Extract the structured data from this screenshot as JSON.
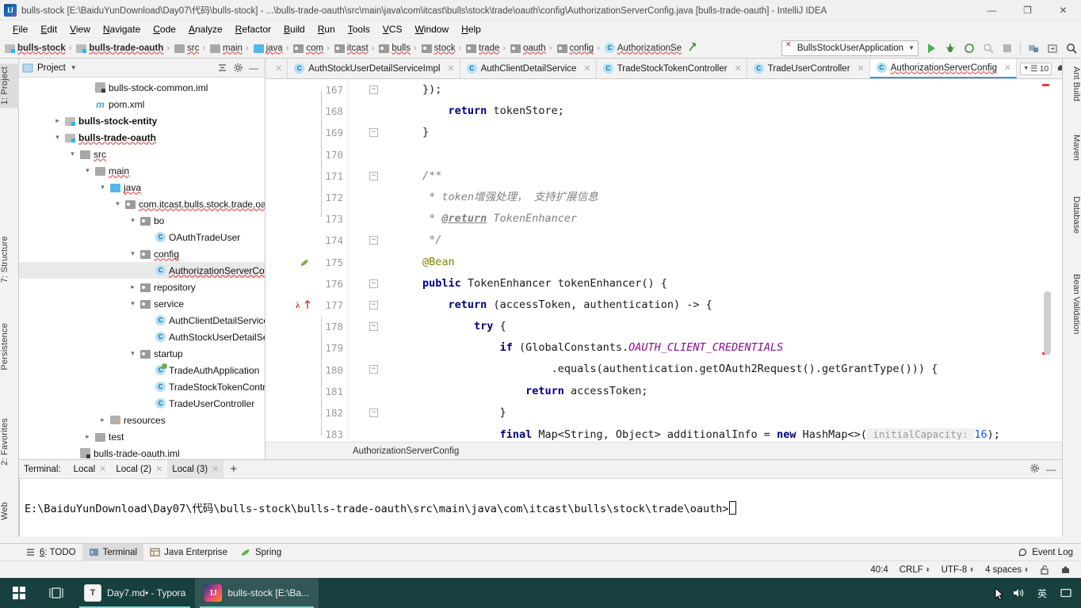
{
  "window": {
    "title": "bulls-stock [E:\\BaiduYunDownload\\Day07\\代码\\bulls-stock] - ...\\bulls-trade-oauth\\src\\main\\java\\com\\itcast\\bulls\\stock\\trade\\oauth\\config\\AuthorizationServerConfig.java [bulls-trade-oauth] - IntelliJ IDEA",
    "logo": "IJ",
    "minimize": "—",
    "maximize": "❐",
    "close": "✕"
  },
  "menu": [
    "File",
    "Edit",
    "View",
    "Navigate",
    "Code",
    "Analyze",
    "Refactor",
    "Build",
    "Run",
    "Tools",
    "VCS",
    "Window",
    "Help"
  ],
  "navbar": {
    "crumbs": [
      {
        "label": "bulls-stock",
        "icon": "module-icon",
        "bold": true
      },
      {
        "label": "bulls-trade-oauth",
        "icon": "module-icon",
        "bold": true
      },
      {
        "label": "src",
        "icon": "folder-icon",
        "bold": false
      },
      {
        "label": "main",
        "icon": "folder-icon",
        "bold": false
      },
      {
        "label": "java",
        "icon": "source-folder-icon",
        "bold": false
      },
      {
        "label": "com",
        "icon": "package-icon",
        "bold": false
      },
      {
        "label": "itcast",
        "icon": "package-icon",
        "bold": false
      },
      {
        "label": "bulls",
        "icon": "package-icon",
        "bold": false
      },
      {
        "label": "stock",
        "icon": "package-icon",
        "bold": false
      },
      {
        "label": "trade",
        "icon": "package-icon",
        "bold": false
      },
      {
        "label": "oauth",
        "icon": "package-icon",
        "bold": false
      },
      {
        "label": "config",
        "icon": "package-icon",
        "bold": false
      },
      {
        "label": "AuthorizationSe",
        "icon": "class-icon",
        "bold": false
      }
    ],
    "run_config": "BullsStockUserApplication",
    "buttons": [
      "run-icon",
      "debug-icon",
      "run-coverage-icon",
      "profiler-icon",
      "stop-icon",
      "build-project-icon",
      "select-opened-file-icon",
      "search-everywhere-icon"
    ]
  },
  "left_tool_tabs": [
    {
      "label": "1: Project",
      "selected": true
    },
    {
      "label": "7: Structure",
      "selected": false
    },
    {
      "label": "Persistence",
      "selected": false
    },
    {
      "label": "2: Favorites",
      "selected": false
    },
    {
      "label": "Web",
      "selected": false
    }
  ],
  "right_tool_tabs": [
    "Ant Build",
    "Maven",
    "Database",
    "Bean Validation"
  ],
  "project_panel": {
    "title": "Project",
    "collapse_all": "collapse-all-icon",
    "settings": "gear-icon",
    "hide": "hide-icon",
    "tree": [
      {
        "label": "bulls-stock-common.iml",
        "indent": 4,
        "icon": "iml-icon",
        "twisty": "",
        "bold": false,
        "selected": false,
        "squiggle": false
      },
      {
        "label": "pom.xml",
        "indent": 4,
        "icon": "maven-icon",
        "twisty": "",
        "bold": false,
        "selected": false,
        "squiggle": false
      },
      {
        "label": "bulls-stock-entity",
        "indent": 2,
        "icon": "module-icon",
        "twisty": "collapsed",
        "bold": true,
        "selected": false,
        "squiggle": false
      },
      {
        "label": "bulls-trade-oauth",
        "indent": 2,
        "icon": "module-icon",
        "twisty": "expanded",
        "bold": true,
        "selected": false,
        "squiggle": true
      },
      {
        "label": "src",
        "indent": 3,
        "icon": "folder-icon",
        "twisty": "expanded",
        "bold": false,
        "selected": false,
        "squiggle": true
      },
      {
        "label": "main",
        "indent": 4,
        "icon": "folder-icon",
        "twisty": "expanded",
        "bold": false,
        "selected": false,
        "squiggle": true
      },
      {
        "label": "java",
        "indent": 5,
        "icon": "source-folder-icon",
        "twisty": "expanded",
        "bold": false,
        "selected": false,
        "squiggle": true
      },
      {
        "label": "com.itcast.bulls.stock.trade.oa",
        "indent": 6,
        "icon": "package-icon",
        "twisty": "expanded",
        "bold": false,
        "selected": false,
        "squiggle": true
      },
      {
        "label": "bo",
        "indent": 7,
        "icon": "package-icon",
        "twisty": "expanded",
        "bold": false,
        "selected": false,
        "squiggle": false
      },
      {
        "label": "OAuthTradeUser",
        "indent": 8,
        "icon": "class-icon",
        "twisty": "",
        "bold": false,
        "selected": false,
        "squiggle": false
      },
      {
        "label": "config",
        "indent": 7,
        "icon": "package-icon",
        "twisty": "expanded",
        "bold": false,
        "selected": false,
        "squiggle": true
      },
      {
        "label": "AuthorizationServerCon",
        "indent": 8,
        "icon": "class-icon",
        "twisty": "",
        "bold": false,
        "selected": true,
        "squiggle": true
      },
      {
        "label": "repository",
        "indent": 7,
        "icon": "package-icon",
        "twisty": "collapsed",
        "bold": false,
        "selected": false,
        "squiggle": false
      },
      {
        "label": "service",
        "indent": 7,
        "icon": "package-icon",
        "twisty": "expanded",
        "bold": false,
        "selected": false,
        "squiggle": false
      },
      {
        "label": "AuthClientDetailService",
        "indent": 8,
        "icon": "class-icon",
        "twisty": "",
        "bold": false,
        "selected": false,
        "squiggle": false
      },
      {
        "label": "AuthStockUserDetailSe",
        "indent": 8,
        "icon": "class-icon",
        "twisty": "",
        "bold": false,
        "selected": false,
        "squiggle": false
      },
      {
        "label": "startup",
        "indent": 7,
        "icon": "package-icon",
        "twisty": "expanded",
        "bold": false,
        "selected": false,
        "squiggle": false
      },
      {
        "label": "TradeAuthApplication",
        "indent": 8,
        "icon": "spring-class-icon",
        "twisty": "",
        "bold": false,
        "selected": false,
        "squiggle": false
      },
      {
        "label": "TradeStockTokenContr",
        "indent": 8,
        "icon": "class-icon",
        "twisty": "",
        "bold": false,
        "selected": false,
        "squiggle": false
      },
      {
        "label": "TradeUserController",
        "indent": 8,
        "icon": "class-icon",
        "twisty": "",
        "bold": false,
        "selected": false,
        "squiggle": false
      },
      {
        "label": "resources",
        "indent": 5,
        "icon": "resources-icon",
        "twisty": "collapsed",
        "bold": false,
        "selected": false,
        "squiggle": false
      },
      {
        "label": "test",
        "indent": 4,
        "icon": "folder-icon",
        "twisty": "collapsed",
        "bold": false,
        "selected": false,
        "squiggle": false
      },
      {
        "label": "bulls-trade-oauth.iml",
        "indent": 3,
        "icon": "iml-icon",
        "twisty": "",
        "bold": false,
        "selected": false,
        "squiggle": false
      }
    ]
  },
  "editor": {
    "tabs": [
      {
        "label": "AuthStockUserDetailServiceImpl",
        "icon": "class-icon",
        "active": false
      },
      {
        "label": "AuthClientDetailService",
        "icon": "class-icon",
        "active": false
      },
      {
        "label": "TradeStockTokenController",
        "icon": "class-icon",
        "active": false
      },
      {
        "label": "TradeUserController",
        "icon": "class-icon",
        "active": false
      },
      {
        "label": "AuthorizationServerConfig",
        "icon": "class-icon",
        "active": true
      }
    ],
    "tab_count": "10",
    "breadcrumb": "AuthorizationServerConfig",
    "first_line_number": 167,
    "lines": [
      {
        "n": 167,
        "fold": "minus",
        "segments": [
          {
            "t": "        });",
            "c": ""
          }
        ]
      },
      {
        "n": 168,
        "fold": "",
        "segments": [
          {
            "t": "            ",
            "c": ""
          },
          {
            "t": "return",
            "c": "kw"
          },
          {
            "t": " tokenStore;",
            "c": ""
          }
        ]
      },
      {
        "n": 169,
        "fold": "minus",
        "segments": [
          {
            "t": "        }",
            "c": ""
          }
        ]
      },
      {
        "n": 170,
        "fold": "",
        "segments": [
          {
            "t": "",
            "c": ""
          }
        ]
      },
      {
        "n": 171,
        "fold": "minus",
        "segments": [
          {
            "t": "        /**",
            "c": "cm"
          }
        ]
      },
      {
        "n": 172,
        "fold": "",
        "segments": [
          {
            "t": "         * token增强处理， 支持扩展信息",
            "c": "cm"
          }
        ]
      },
      {
        "n": 173,
        "fold": "",
        "segments": [
          {
            "t": "         * ",
            "c": "cm"
          },
          {
            "t": "@return",
            "c": "cmtag"
          },
          {
            "t": " TokenEnhancer",
            "c": "cm"
          }
        ]
      },
      {
        "n": 174,
        "fold": "minus",
        "segments": [
          {
            "t": "         */",
            "c": "cm"
          }
        ]
      },
      {
        "n": 175,
        "fold": "",
        "gutter_icon": "spring-bean-icon",
        "segments": [
          {
            "t": "        ",
            "c": ""
          },
          {
            "t": "@Bean",
            "c": "anno"
          }
        ]
      },
      {
        "n": 176,
        "fold": "minus",
        "segments": [
          {
            "t": "        ",
            "c": ""
          },
          {
            "t": "public",
            "c": "kw"
          },
          {
            "t": " TokenEnhancer tokenEnhancer() {",
            "c": ""
          }
        ]
      },
      {
        "n": 177,
        "fold": "minus",
        "gutter_icon": "lambda-override-icon",
        "segments": [
          {
            "t": "            ",
            "c": ""
          },
          {
            "t": "return",
            "c": "kw"
          },
          {
            "t": " (accessToken, authentication) -> {",
            "c": ""
          }
        ]
      },
      {
        "n": 178,
        "fold": "minus",
        "segments": [
          {
            "t": "                ",
            "c": ""
          },
          {
            "t": "try",
            "c": "kw"
          },
          {
            "t": " {",
            "c": ""
          }
        ]
      },
      {
        "n": 179,
        "fold": "",
        "segments": [
          {
            "t": "                    ",
            "c": ""
          },
          {
            "t": "if",
            "c": "kw"
          },
          {
            "t": " (GlobalConstants.",
            "c": ""
          },
          {
            "t": "OAUTH_CLIENT_CREDENTIALS",
            "c": "cst"
          }
        ]
      },
      {
        "n": 180,
        "fold": "minus",
        "segments": [
          {
            "t": "                            .equals(authentication.getOAuth2Request().getGrantType())) {",
            "c": ""
          }
        ]
      },
      {
        "n": 181,
        "fold": "",
        "segments": [
          {
            "t": "                        ",
            "c": ""
          },
          {
            "t": "return",
            "c": "kw"
          },
          {
            "t": " accessToken;",
            "c": ""
          }
        ]
      },
      {
        "n": 182,
        "fold": "minus",
        "segments": [
          {
            "t": "                    }",
            "c": ""
          }
        ]
      },
      {
        "n": 183,
        "fold": "",
        "segments": [
          {
            "t": "                    ",
            "c": ""
          },
          {
            "t": "final",
            "c": "kw"
          },
          {
            "t": " Map<String, Object> additionalInfo = ",
            "c": ""
          },
          {
            "t": "new",
            "c": "kw"
          },
          {
            "t": " HashMap<>(",
            "c": ""
          },
          {
            "t": " initialCapacity: ",
            "c": "hint"
          },
          {
            "t": "16",
            "c": "num"
          },
          {
            "t": ");",
            "c": ""
          }
        ]
      }
    ]
  },
  "terminal": {
    "title": "Terminal:",
    "tabs": [
      {
        "label": "Local",
        "active": false
      },
      {
        "label": "Local (2)",
        "active": false
      },
      {
        "label": "Local (3)",
        "active": true
      }
    ],
    "add": "+",
    "settings": "gear-icon",
    "hide": "hide-icon",
    "prompt": "E:\\BaiduYunDownload\\Day07\\代码\\bulls-stock\\bulls-trade-oauth\\src\\main\\java\\com\\itcast\\bulls\\stock\\trade\\oauth>"
  },
  "bottom_tabs": [
    {
      "label": "6: TODO",
      "icon": "todo-icon",
      "active": false
    },
    {
      "label": "Terminal",
      "icon": "terminal-icon",
      "active": true
    },
    {
      "label": "Java Enterprise",
      "icon": "java-ee-icon",
      "active": false
    },
    {
      "label": "Spring",
      "icon": "spring-icon",
      "active": false
    }
  ],
  "event_log": "Event Log",
  "statusbar": {
    "position": "40:4",
    "line_separator": "CRLF",
    "encoding": "UTF-8",
    "indent": "4 spaces",
    "lock": "unlock-icon",
    "inspector": "inspector-icon"
  },
  "taskbar": {
    "start": "windows-start-icon",
    "taskview": "task-view-icon",
    "apps": [
      {
        "label": "Day7.md• - Typora",
        "icon": "T",
        "active": false
      },
      {
        "label": "bulls-stock [E:\\Ba...",
        "icon": "IJ",
        "active": true
      }
    ],
    "tray": [
      "^",
      "sound-icon",
      "英",
      "notification-icon"
    ]
  },
  "colors": {
    "accent": "#4a90d9",
    "keyword": "#000080",
    "comment": "#808080",
    "annotation": "#808000",
    "constant": "#871094",
    "number": "#1750eb",
    "taskbar": "#17403f",
    "error": "#e05a5a"
  }
}
